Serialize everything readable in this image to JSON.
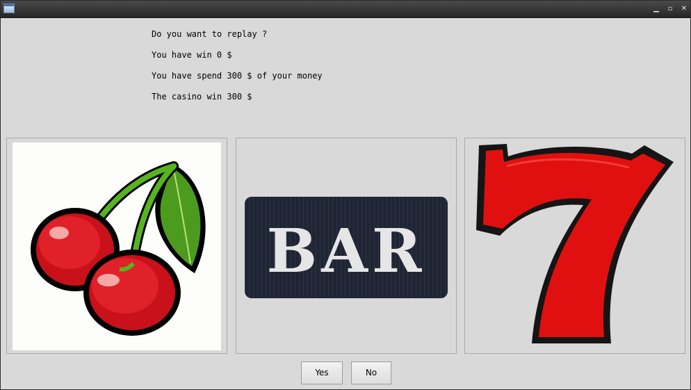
{
  "window": {
    "minimize_glyph": "▁",
    "maximize_glyph": "▫",
    "close_glyph": "✕"
  },
  "messages": [
    "Do you want to replay ?",
    "You have win 0 $",
    "You have spend 300 $ of your money",
    "The casino win 300 $"
  ],
  "reels": [
    {
      "symbol": "cherries-icon"
    },
    {
      "symbol": "bar-icon",
      "text": "BAR"
    },
    {
      "symbol": "seven-icon"
    }
  ],
  "buttons": {
    "yes": "Yes",
    "no": "No"
  },
  "colors": {
    "background": "#d9d9d9",
    "cherry_red": "#d7141b",
    "seven_red": "#e01010",
    "bar_dark": "#1f2533",
    "leaf_green": "#4c9a1e"
  }
}
